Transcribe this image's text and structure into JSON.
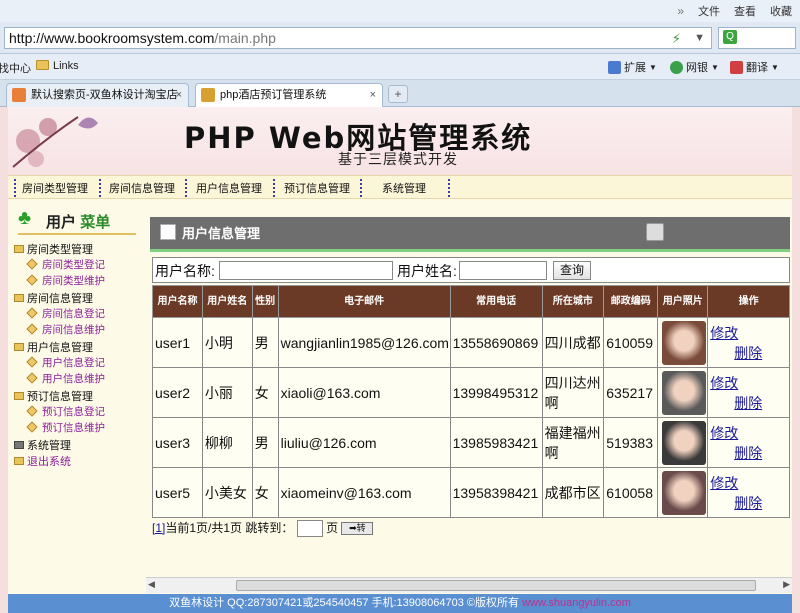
{
  "browser": {
    "menu": [
      "文件",
      "查看",
      "收藏"
    ],
    "address_host": "http://www.bookroomsystem.com",
    "address_path": "/main.php",
    "favorites": {
      "left_fragment": "找中心",
      "links": "Links",
      "expand": "扩展",
      "netbank": "网银",
      "translate": "翻译"
    },
    "tabs": [
      {
        "label": "默认搜索页-双鱼林设计淘宝店"
      },
      {
        "label": "php酒店预订管理系统"
      }
    ],
    "new_tab": "+",
    "tab_close": "×"
  },
  "banner": {
    "title": "PHP Web网站管理系统",
    "subtitle": "基于三层模式开发"
  },
  "nav": [
    "房间类型管理",
    "房间信息管理",
    "用户信息管理",
    "预订信息管理",
    "系统管理"
  ],
  "sidebar": {
    "title_a": "用户",
    "title_b": "菜单",
    "groups": [
      {
        "label": "房间类型管理",
        "items": [
          "房间类型登记",
          "房间类型维护"
        ]
      },
      {
        "label": "房间信息管理",
        "items": [
          "房间信息登记",
          "房间信息维护"
        ]
      },
      {
        "label": "用户信息管理",
        "items": [
          "用户信息登记",
          "用户信息维护"
        ]
      },
      {
        "label": "预订信息管理",
        "items": [
          "预订信息登记",
          "预订信息维护"
        ]
      },
      {
        "label": "系统管理",
        "items": []
      },
      {
        "label": "退出系统",
        "items": []
      }
    ]
  },
  "main": {
    "panel_title": "用户信息管理",
    "search": {
      "name_label": "用户名称:",
      "realname_label": "用户姓名:",
      "button": "查询"
    },
    "table": {
      "headers": [
        "用户名称",
        "用户姓名",
        "性别",
        "电子邮件",
        "常用电话",
        "所在城市",
        "邮政编码",
        "用户照片",
        "操作"
      ],
      "rows": [
        {
          "username": "user1",
          "name": "小明",
          "sex": "男",
          "email": "wangjianlin1985@126.com",
          "phone": "13558690869",
          "city": "四川成都",
          "zip": "610059",
          "photo_color": "#7a4a3a"
        },
        {
          "username": "user2",
          "name": "小丽",
          "sex": "女",
          "email": "xiaoli@163.com",
          "phone": "13998495312",
          "city": "四川达州啊",
          "zip": "635217",
          "photo_color": "#5a5a5a"
        },
        {
          "username": "user3",
          "name": "柳柳",
          "sex": "男",
          "email": "liuliu@126.com",
          "phone": "13985983421",
          "city": "福建福州啊",
          "zip": "519383",
          "photo_color": "#3a3a3a"
        },
        {
          "username": "user5",
          "name": "小美女",
          "sex": "女",
          "email": "xiaomeinv@163.com",
          "phone": "13958398421",
          "city": "成都市区",
          "zip": "610058",
          "photo_color": "#6a4a4a"
        }
      ],
      "edit": "修改",
      "delete": "删除"
    },
    "pager": {
      "page_link": "[1]",
      "text": "当前1页/共1页 跳转到：",
      "page_unit": "页",
      "go": "➡转"
    }
  },
  "footer": {
    "text": "双鱼林设计 QQ:287307421或254540457 手机:13908064703 ©版权所有 ",
    "link": "www.shuangyulin.com"
  }
}
